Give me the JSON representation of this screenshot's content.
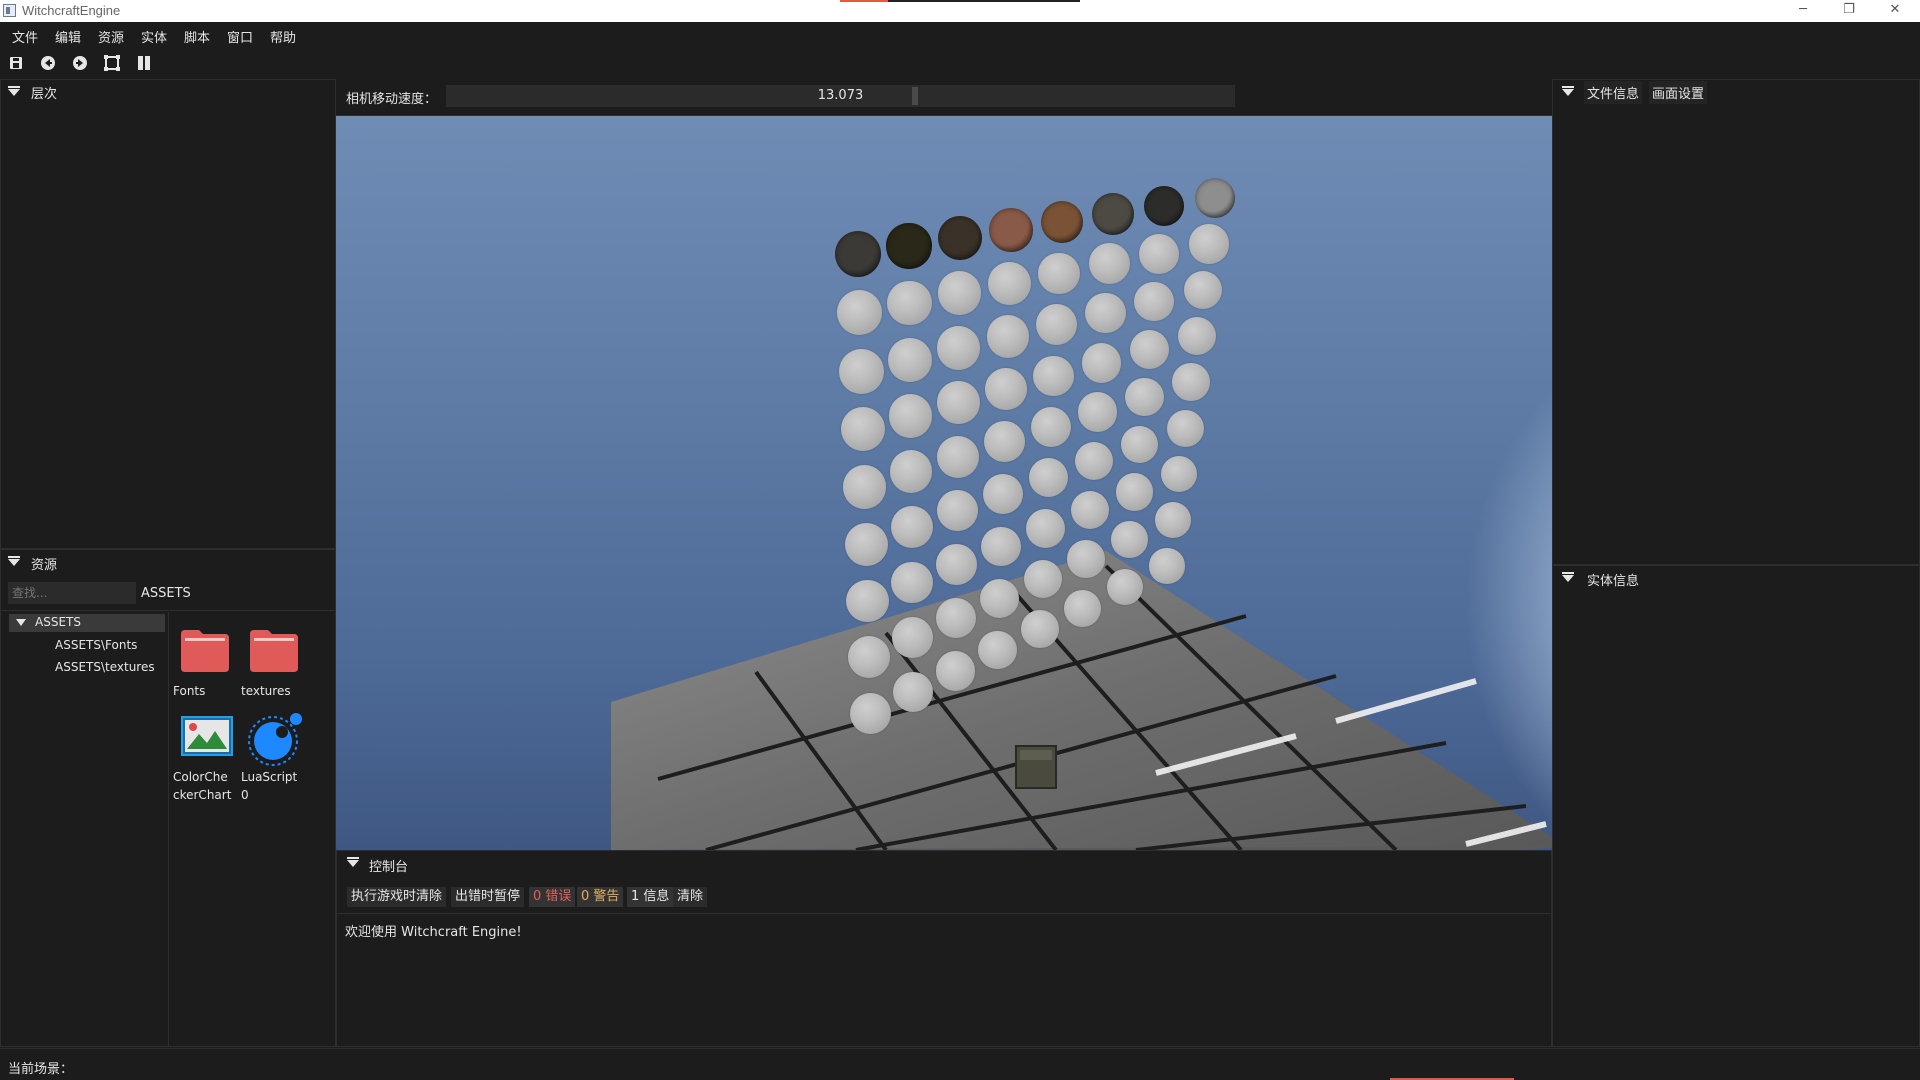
{
  "window": {
    "title": "WitchcraftEngine",
    "minimize_glyph": "─",
    "restore_glyph": "❐",
    "close_glyph": "✕"
  },
  "menu": [
    "文件",
    "编辑",
    "资源",
    "实体",
    "脚本",
    "窗口",
    "帮助"
  ],
  "toolbar": {
    "icons": [
      "save-icon",
      "undo-icon",
      "redo-icon",
      "fit-view-icon",
      "pause-icon"
    ]
  },
  "hierarchy": {
    "title": "层次"
  },
  "assets": {
    "title": "资源",
    "search_placeholder": "查找...",
    "path": "ASSETS",
    "tree": {
      "root": "ASSETS",
      "children": [
        "ASSETS\\Fonts",
        "ASSETS\\textures"
      ]
    },
    "files": [
      {
        "name": "Fonts",
        "type": "folder"
      },
      {
        "name": "textures",
        "type": "folder"
      },
      {
        "name": "ColorChe ckerChart",
        "line1": "ColorChe",
        "line2": "ckerChart",
        "type": "image"
      },
      {
        "name": "LuaScript 0",
        "line1": "LuaScript",
        "line2": "0",
        "type": "script"
      }
    ]
  },
  "viewport": {
    "camera_speed_label": "相机移动速度：",
    "camera_speed_value": "13.073",
    "camera_speed_fraction": 0.59
  },
  "right_panel": {
    "tabs": [
      "文件信息",
      "画面设置"
    ],
    "entity_title": "实体信息"
  },
  "console": {
    "title": "控制台",
    "buttons": {
      "clear_on_play": "执行游戏时清除",
      "pause_on_error": "出错时暂停",
      "errors": "0 错误",
      "warnings": "0 警告",
      "infos": "1 信息",
      "clear": "清除"
    },
    "messages": [
      "欢迎使用 Witchcraft Engine!"
    ]
  },
  "status": {
    "current_scene_label": "当前场景："
  },
  "colors": {
    "error": "#e06060",
    "warning": "#e0b060",
    "folder": "#e05a5a",
    "script": "#1e88ff",
    "accent_bar": "#e05a4a"
  }
}
